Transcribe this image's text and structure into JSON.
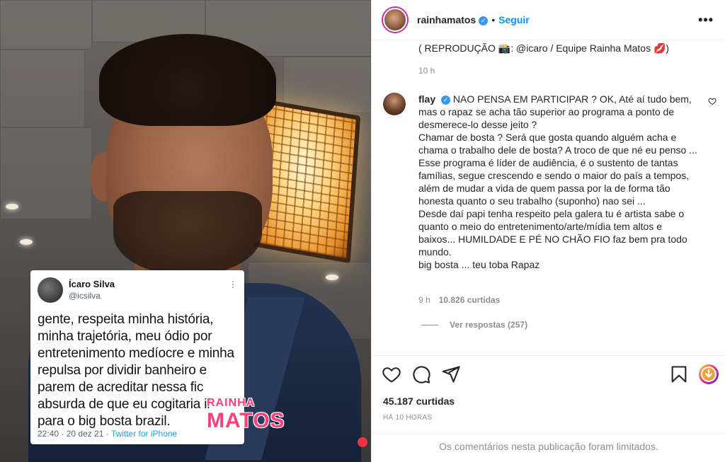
{
  "post": {
    "tweet": {
      "name": "Ícaro Silva",
      "handle": "@icsilva",
      "more": "⋮",
      "text": "gente, respeita minha história,\nminha trajetória, meu ódio por\nentretenimento medíocre e minha\nrepulsa por dividir banheiro e\nparem de acreditar nessa fic\nabsurda de que eu cogitaria ir\npara o big bosta brazil.",
      "date": "22:40 · 20 dez 21 · ",
      "source": "Twitter for iPhone"
    },
    "watermark": {
      "line1": "RAINHA",
      "line2": "MATOS"
    }
  },
  "header": {
    "username": "rainhamatos",
    "verified": "✓",
    "separator": "•",
    "follow": "Seguir",
    "more": "•••"
  },
  "caption": {
    "tail": "( REPRODUÇÃO 📸: @icaro / Equipe Rainha Matos 💋)",
    "time": "10 h"
  },
  "comment": {
    "user": "flay",
    "verified": "✓",
    "text": "NAO PENSA EM PARTICIPAR ? OK, Até aí tudo bem, mas o rapaz se acha tão superior ao programa a ponto de desmerece-lo desse jeito ?\nChamar de bosta ? Será que gosta quando alguém acha e chama o trabalho dele de bosta? A troco de que né eu penso ...\nEsse programa é líder de audiência, é o sustento de tantas famílias, segue crescendo e sendo o maior do país a tempos, além de mudar a vida de quem passa por la de forma tão honesta quanto o seu trabalho (suponho) nao sei ...\nDesde daí papi tenha respeito pela galera tu é artista sabe o quanto o meio do entretenimento/arte/mídia tem altos e baixos... HUMILDADE E PÉ NO CHÃO FIO faz bem pra todo mundo.\nbig bosta ... teu toba Rapaz",
    "time": "9 h",
    "likes": "10.826 curtidas",
    "replies": "Ver respostas (257)"
  },
  "actions": {
    "likes": "45.187 curtidas",
    "time_ago": "HÁ 10 HORAS",
    "limited": "Os comentários nesta publicação foram limitados."
  }
}
